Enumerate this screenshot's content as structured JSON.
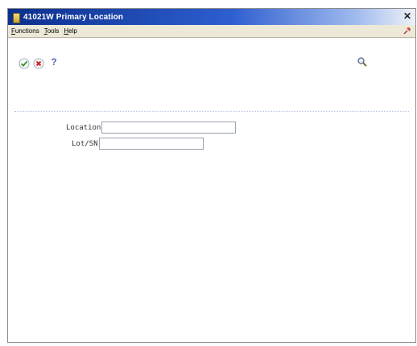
{
  "window": {
    "title": "41021W  Primary Location",
    "close_glyph": "✕"
  },
  "menubar": {
    "items": [
      {
        "mnemonic": "F",
        "rest": "unctions"
      },
      {
        "mnemonic": "T",
        "rest": "ools"
      },
      {
        "mnemonic": "H",
        "rest": "elp"
      }
    ]
  },
  "toolbar": {
    "ok_icon": "check-icon",
    "cancel_icon": "x-icon",
    "help_glyph": "?",
    "find_icon": "magnifier-icon"
  },
  "form": {
    "location": {
      "label": "Location",
      "value": ""
    },
    "lot": {
      "label": "Lot/SN",
      "value": ""
    }
  },
  "colors": {
    "title_start": "#0b2f8c",
    "title_end": "#eef1f8",
    "menubar_bg": "#ece9d8",
    "ok_green": "#3a9a2e",
    "cancel_red": "#d02020"
  }
}
